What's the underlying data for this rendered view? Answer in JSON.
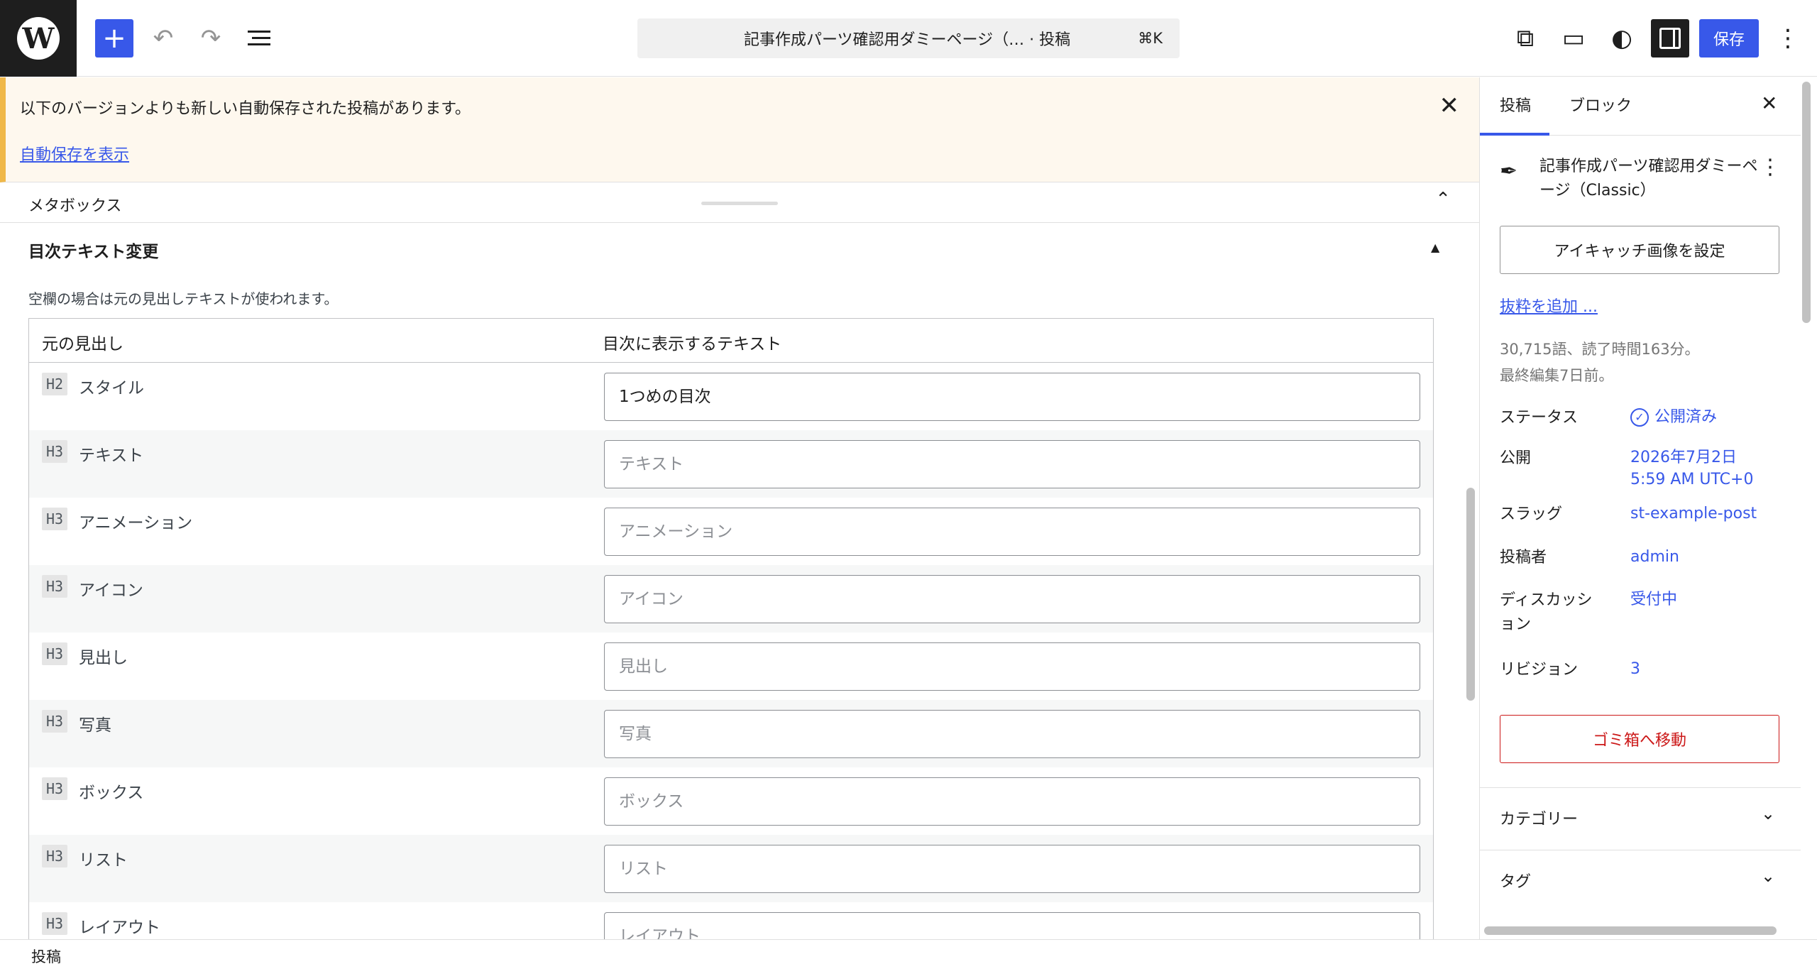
{
  "topbar": {
    "logo_letter": "W",
    "add_icon": "plus-icon",
    "doc_title": "記事作成パーツ確認用ダミーページ（… · 投稿",
    "shortcut": "⌘K",
    "save_label": "保存"
  },
  "notice": {
    "message": "以下のバージョンよりも新しい自動保存された投稿があります。",
    "link": "自動保存を表示"
  },
  "metabox": {
    "title": "メタボックス",
    "box_title": "目次テキスト変更",
    "description": "空欄の場合は元の見出しテキストが使われます。",
    "col_original": "元の見出し",
    "col_toc": "目次に表示するテキスト",
    "rows": [
      {
        "level": "H2",
        "name": "スタイル",
        "value": "1つめの目次",
        "placeholder": ""
      },
      {
        "level": "H3",
        "name": "テキスト",
        "value": "",
        "placeholder": "テキスト"
      },
      {
        "level": "H3",
        "name": "アニメーション",
        "value": "",
        "placeholder": "アニメーション"
      },
      {
        "level": "H3",
        "name": "アイコン",
        "value": "",
        "placeholder": "アイコン"
      },
      {
        "level": "H3",
        "name": "見出し",
        "value": "",
        "placeholder": "見出し"
      },
      {
        "level": "H3",
        "name": "写真",
        "value": "",
        "placeholder": "写真"
      },
      {
        "level": "H3",
        "name": "ボックス",
        "value": "",
        "placeholder": "ボックス"
      },
      {
        "level": "H3",
        "name": "リスト",
        "value": "",
        "placeholder": "リスト"
      },
      {
        "level": "H3",
        "name": "レイアウト",
        "value": "",
        "placeholder": "レイアウト"
      }
    ]
  },
  "footer": {
    "breadcrumb": "投稿"
  },
  "sidebar": {
    "tabs": [
      "投稿",
      "ブロック"
    ],
    "post_title": "記事作成パーツ確認用ダミーページ（Classic）",
    "featured_image_button": "アイキャッチ画像を設定",
    "excerpt_link": "抜粋を追加 ...",
    "stats_line1": "30,715語、読了時間163分。",
    "stats_line2": "最終編集7日前。",
    "status_label": "ステータス",
    "status_value": "公開済み",
    "publish_label": "公開",
    "publish_date": "2026年7月2日",
    "publish_time": "5:59 AM UTC+0",
    "slug_label": "スラッグ",
    "slug_value": "st-example-post",
    "author_label": "投稿者",
    "author_value": "admin",
    "discussion_label_1": "ディスカッシ",
    "discussion_label_2": "ョン",
    "discussion_value": "受付中",
    "revisions_label": "リビジョン",
    "revisions_value": "3",
    "trash_button": "ゴミ箱へ移動",
    "panels": [
      "カテゴリー",
      "タグ"
    ]
  },
  "colors": {
    "accent": "#3858e9",
    "notice_bg": "#fef8ee",
    "notice_border": "#f0b849",
    "danger": "#cc1818"
  }
}
